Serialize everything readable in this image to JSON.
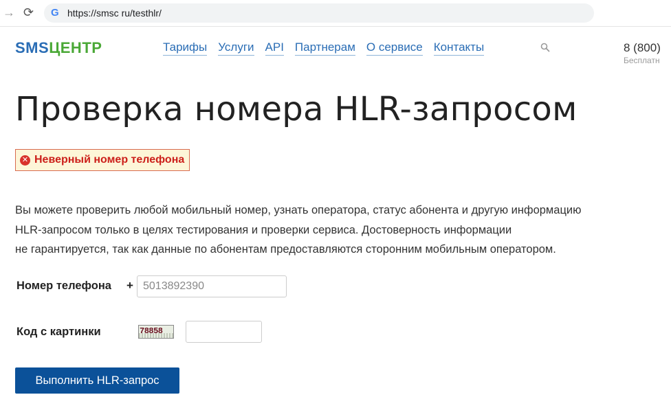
{
  "browser": {
    "url": "https://smsc ru/testhlr/"
  },
  "header": {
    "logo_sms": "SMS",
    "logo_center": "ЦЕНТР",
    "nav": [
      "Тарифы",
      "Услуги",
      "API",
      "Партнерам",
      "О сервисе",
      "Контакты"
    ],
    "phone": "8 (800)",
    "phone_sub": "Бесплатн"
  },
  "main": {
    "title": "Проверка номера HLR-запросом",
    "error": "Неверный номер телефона",
    "description": [
      "Вы можете проверить любой мобильный номер, узнать оператора, статус абонента и другую информацию",
      "HLR-запросом только в целях тестирования и проверки сервиса. Достоверность информации",
      "не гарантируется, так как данные по абонентам предоставляются сторонним мобильным оператором."
    ],
    "phone_label": "Номер телефона",
    "phone_prefix": "+",
    "phone_value": "5013892390",
    "captcha_label": "Код с картинки",
    "captcha_code": "78858",
    "captcha_value": "",
    "submit_label": "Выполнить HLR-запрос"
  },
  "colors": {
    "brand_blue": "#2a6db5",
    "brand_green": "#4aa836",
    "button": "#0b5199",
    "error_text": "#cc1f1a",
    "error_bg": "#fdf6d8"
  }
}
